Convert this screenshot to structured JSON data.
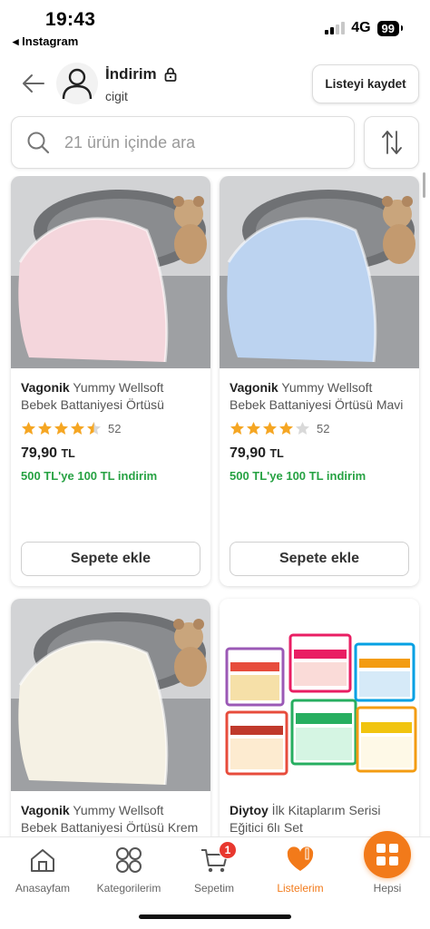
{
  "status_bar": {
    "time": "19:43",
    "back_app": "◂ Instagram",
    "network": "4G",
    "battery": "99"
  },
  "header": {
    "list_title": "İndirim",
    "list_user": "cigit",
    "save_button": "Listeyi kaydet"
  },
  "search": {
    "placeholder": "21 ürün içinde ara"
  },
  "products": [
    {
      "brand": "Vagonik",
      "name": " Yummy Wellsoft Bebek Battaniyesi Örtüsü Pembe",
      "rating": 4.5,
      "rating_count": "52",
      "price": "79,90",
      "currency": "TL",
      "promo": "500 TL'ye 100 TL indirim",
      "button": "Sepete ekle",
      "blanket_color": "#f4d6dc"
    },
    {
      "brand": "Vagonik",
      "name": " Yummy Wellsoft Bebek Battaniyesi Örtüsü Mavi",
      "rating": 4,
      "rating_count": "52",
      "price": "79,90",
      "currency": "TL",
      "promo": "500 TL'ye 100 TL indirim",
      "button": "Sepete ekle",
      "blanket_color": "#bcd3f0"
    },
    {
      "brand": "Vagonik",
      "name": " Yummy Wellsoft Bebek Battaniyesi Örtüsü Krem",
      "blanket_color": "#f5f1e4"
    },
    {
      "brand": "Diytoy",
      "name": " İlk Kitaplarım Serisi Eğitici 6lı Set"
    }
  ],
  "bottom_nav": {
    "items": [
      {
        "label": "Anasayfam",
        "icon": "home-icon",
        "active": false
      },
      {
        "label": "Kategorilerim",
        "icon": "categories-icon",
        "active": false
      },
      {
        "label": "Sepetim",
        "icon": "cart-icon",
        "active": false,
        "badge": "1"
      },
      {
        "label": "Listelerim",
        "icon": "heart-list-icon",
        "active": true
      },
      {
        "label": "Hepsi",
        "icon": "all-grid-icon",
        "active": false
      }
    ]
  },
  "colors": {
    "accent": "#f27a1a",
    "promo_green": "#27a243",
    "star": "#f5a623",
    "badge": "#e8382f"
  }
}
